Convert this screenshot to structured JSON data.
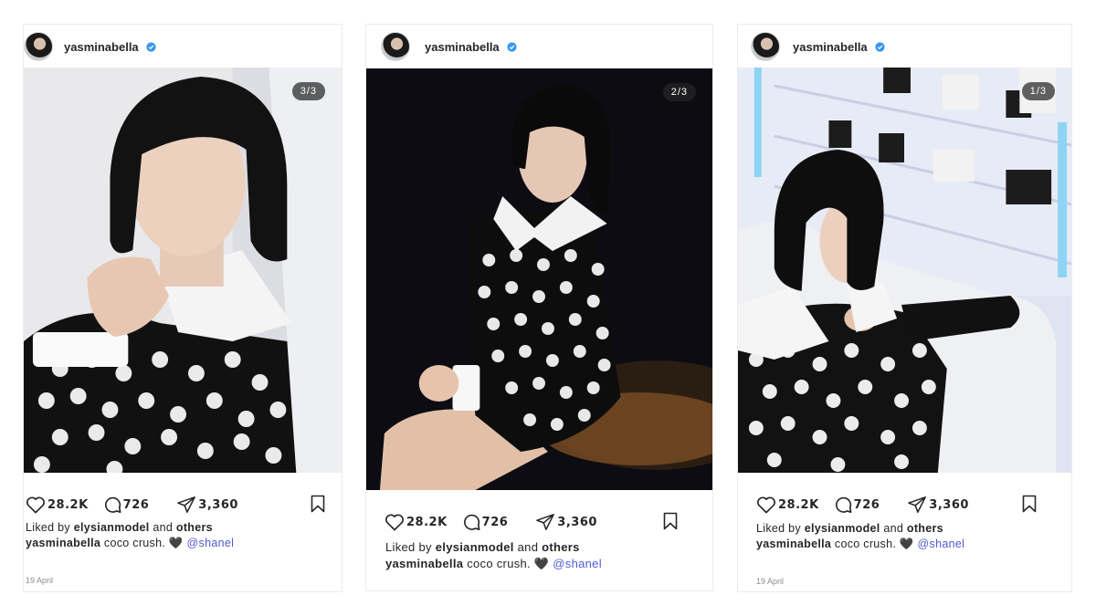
{
  "posts": [
    {
      "username": "yasminabella",
      "verified": true,
      "slide_counter": "3/3",
      "likes": "28.2K",
      "comments": "726",
      "shares": "3,360",
      "liked_by_prefix": "Liked by",
      "liked_by_user": "elysianmodel",
      "liked_by_and": "and",
      "liked_by_others": "others",
      "caption_user": "yasminabella",
      "caption_text": "coco crush. 🖤",
      "caption_mention": "@shanel",
      "date": "19 April"
    },
    {
      "username": "yasminabella",
      "verified": true,
      "slide_counter": "2/3",
      "likes": "28.2K",
      "comments": "726",
      "shares": "3,360",
      "liked_by_prefix": "Liked by",
      "liked_by_user": "elysianmodel",
      "liked_by_and": "and",
      "liked_by_others": "others",
      "caption_user": "yasminabella",
      "caption_text": "coco crush. 🖤",
      "caption_mention": "@shanel"
    },
    {
      "username": "yasminabella",
      "verified": true,
      "slide_counter": "1/3",
      "likes": "28.2K",
      "comments": "726",
      "shares": "3,360",
      "liked_by_prefix": "Liked by",
      "liked_by_user": "elysianmodel",
      "liked_by_and": "and",
      "liked_by_others": "others",
      "caption_user": "yasminabella",
      "caption_text": "coco crush. 🖤",
      "caption_mention": "@shanel",
      "date": "19 April"
    }
  ],
  "icons": {
    "verified": "verified-badge-icon",
    "like": "heart-icon",
    "comment": "comment-bubble-icon",
    "share": "paper-plane-icon",
    "save": "bookmark-icon"
  },
  "colors": {
    "verified_badge": "#3897f0",
    "mention": "#4f5bd5",
    "text": "#262626",
    "muted": "#8e8e8e"
  }
}
